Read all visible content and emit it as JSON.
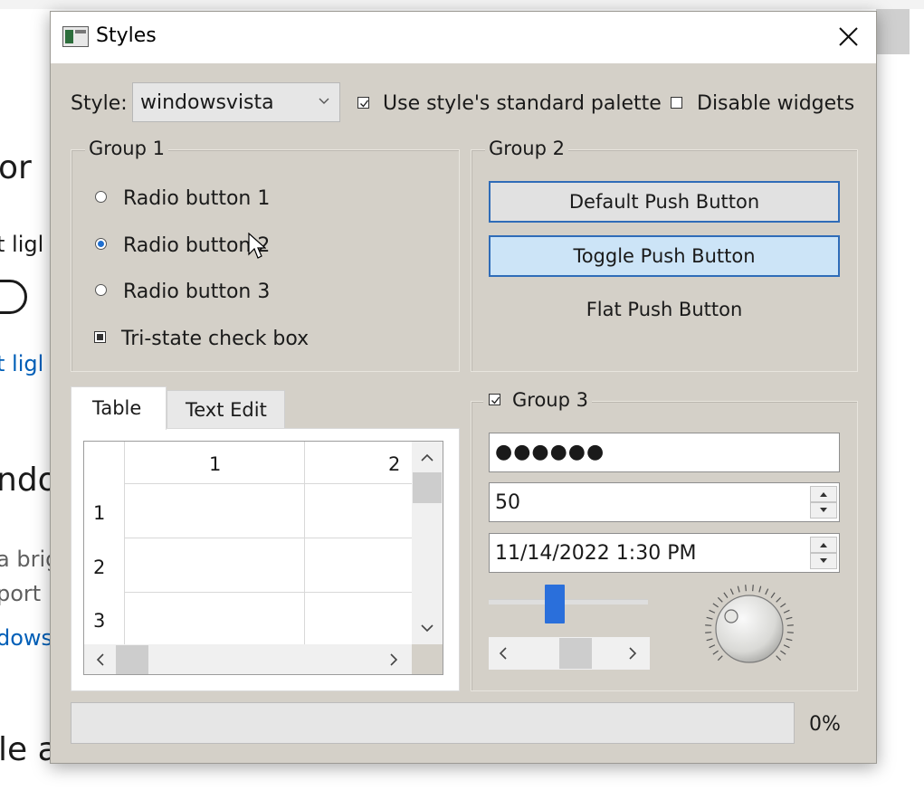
{
  "background_app": {
    "fragments": [
      "or",
      "t ligl",
      "t ligl",
      "ndo",
      "a brig",
      "port H",
      "dows",
      "le a"
    ]
  },
  "dialog": {
    "title": "Styles",
    "style_row": {
      "label": "Style:",
      "selected": "windowsvista",
      "use_palette_label": "Use style's standard palette",
      "use_palette_checked": true,
      "disable_widgets_label": "Disable widgets",
      "disable_widgets_checked": false
    },
    "group1": {
      "title": "Group 1",
      "radios": [
        {
          "label": "Radio button 1",
          "checked": false
        },
        {
          "label": "Radio button 2",
          "checked": true
        },
        {
          "label": "Radio button 3",
          "checked": false
        }
      ],
      "tristate_label": "Tri-state check box"
    },
    "group2": {
      "title": "Group 2",
      "default_button": "Default Push Button",
      "toggle_button": "Toggle Push Button",
      "flat_button": "Flat Push Button"
    },
    "tabs": {
      "items": [
        "Table",
        "Text Edit"
      ],
      "active": "Table",
      "table": {
        "columns": [
          "1",
          "2"
        ],
        "rows": [
          "1",
          "2",
          "3"
        ]
      }
    },
    "group3": {
      "title": "Group 3",
      "checked": true,
      "password_value": "●●●●●●",
      "spin_value": "50",
      "datetime_value": "11/14/2022 1:30 PM",
      "slider_fraction": 0.4,
      "dial_label": "dial"
    },
    "progress": {
      "percent": 0,
      "label": "0%"
    }
  }
}
